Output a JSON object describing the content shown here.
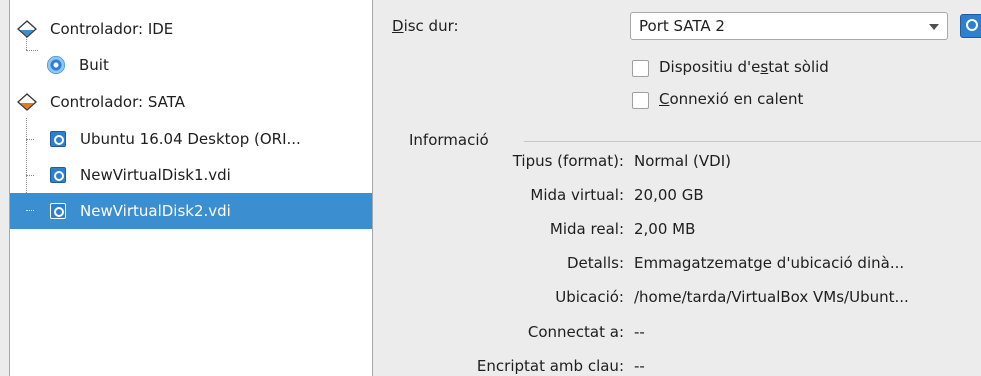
{
  "tree": {
    "ide_controller": "Controlador: IDE",
    "ide_empty": "Buit",
    "sata_controller": "Controlador: SATA",
    "sata_items": [
      "Ubuntu 16.04 Desktop (ORI...",
      "NewVirtualDisk1.vdi",
      "NewVirtualDisk2.vdi"
    ],
    "selected_index": 2
  },
  "attributes": {
    "hard_disk_label_prefix": "D",
    "hard_disk_label_rest": "isc dur:",
    "hard_disk_value": "Port SATA 2",
    "ssd_label_pre": "Dispositiu d'e",
    "ssd_label_accel": "s",
    "ssd_label_post": "tat sòlid",
    "ssd_checked": false,
    "hotplug_label_accel": "C",
    "hotplug_label_rest": "onnexió en calent",
    "hotplug_checked": false
  },
  "info": {
    "title": "Informació",
    "rows": [
      {
        "label": "Tipus (format):",
        "value": "Normal (VDI)"
      },
      {
        "label": "Mida virtual:",
        "value": "20,00 GB"
      },
      {
        "label": "Mida real:",
        "value": "2,00 MB"
      },
      {
        "label": "Detalls:",
        "value": "Emmagatzematge d'ubicació dinà..."
      },
      {
        "label": "Ubicació:",
        "value": "/home/tarda/VirtualBox VMs/Ubunt..."
      },
      {
        "label": "Connectat a:",
        "value": "--"
      },
      {
        "label": "Encriptat amb clau:",
        "value": "--"
      }
    ]
  },
  "colors": {
    "selection": "#3b8ed0",
    "panel": "#ececec",
    "tree_bg": "#ffffff"
  }
}
